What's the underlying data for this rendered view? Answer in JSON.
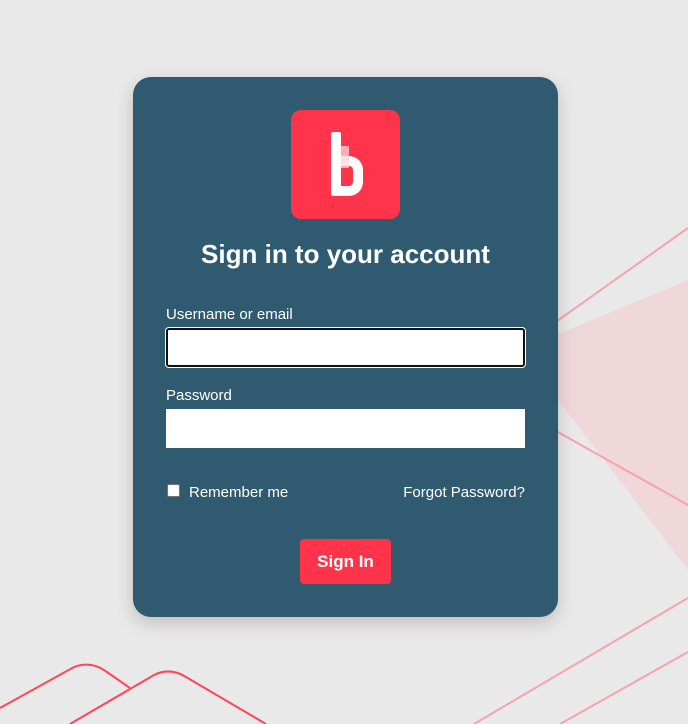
{
  "login": {
    "logo_letter": "b",
    "title": "Sign in to your account",
    "username_label": "Username or email",
    "username_value": "",
    "password_label": "Password",
    "password_value": "",
    "remember_label": "Remember me",
    "remember_checked": false,
    "forgot_link": "Forgot Password?",
    "signin_button": "Sign In"
  },
  "colors": {
    "background": "#eae9e9",
    "card": "#2f5a70",
    "accent": "#ff3349",
    "text": "#ffffff"
  },
  "icons": {
    "logo": "brand-b-logo-icon",
    "checkbox": "checkbox-unchecked-icon"
  }
}
